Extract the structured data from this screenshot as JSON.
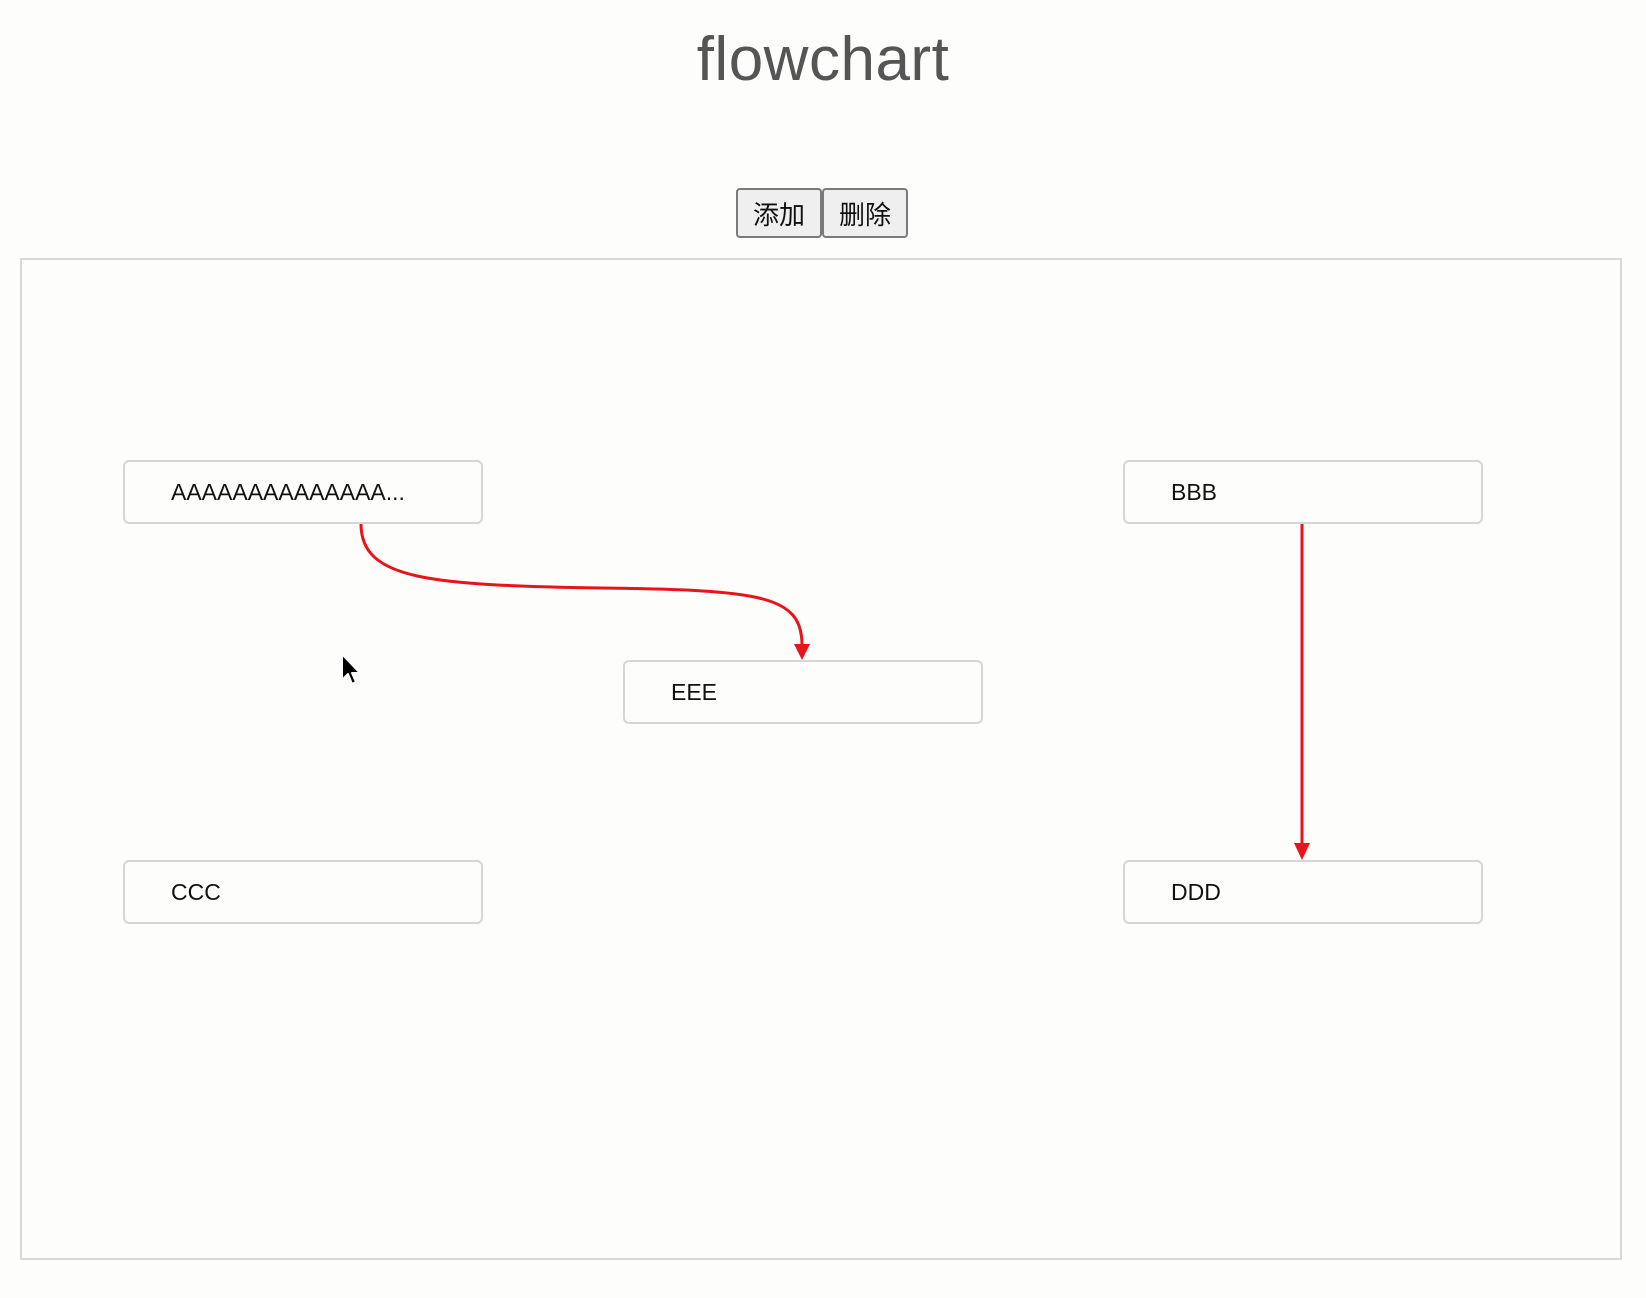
{
  "page": {
    "title": "flowchart"
  },
  "toolbar": {
    "add_label": "添加",
    "delete_label": "删除"
  },
  "nodes": [
    {
      "id": "A",
      "label": "AAAAAAAAAAAAAA..."
    },
    {
      "id": "B",
      "label": "BBB"
    },
    {
      "id": "E",
      "label": "EEE"
    },
    {
      "id": "C",
      "label": "CCC"
    },
    {
      "id": "D",
      "label": "DDD"
    }
  ],
  "edges": [
    {
      "from": "A",
      "to": "E",
      "style": "curve"
    },
    {
      "from": "B",
      "to": "D",
      "style": "straight"
    }
  ],
  "colors": {
    "edge": "#e8141b",
    "node_border": "#d6d6d6",
    "title": "#555555"
  }
}
